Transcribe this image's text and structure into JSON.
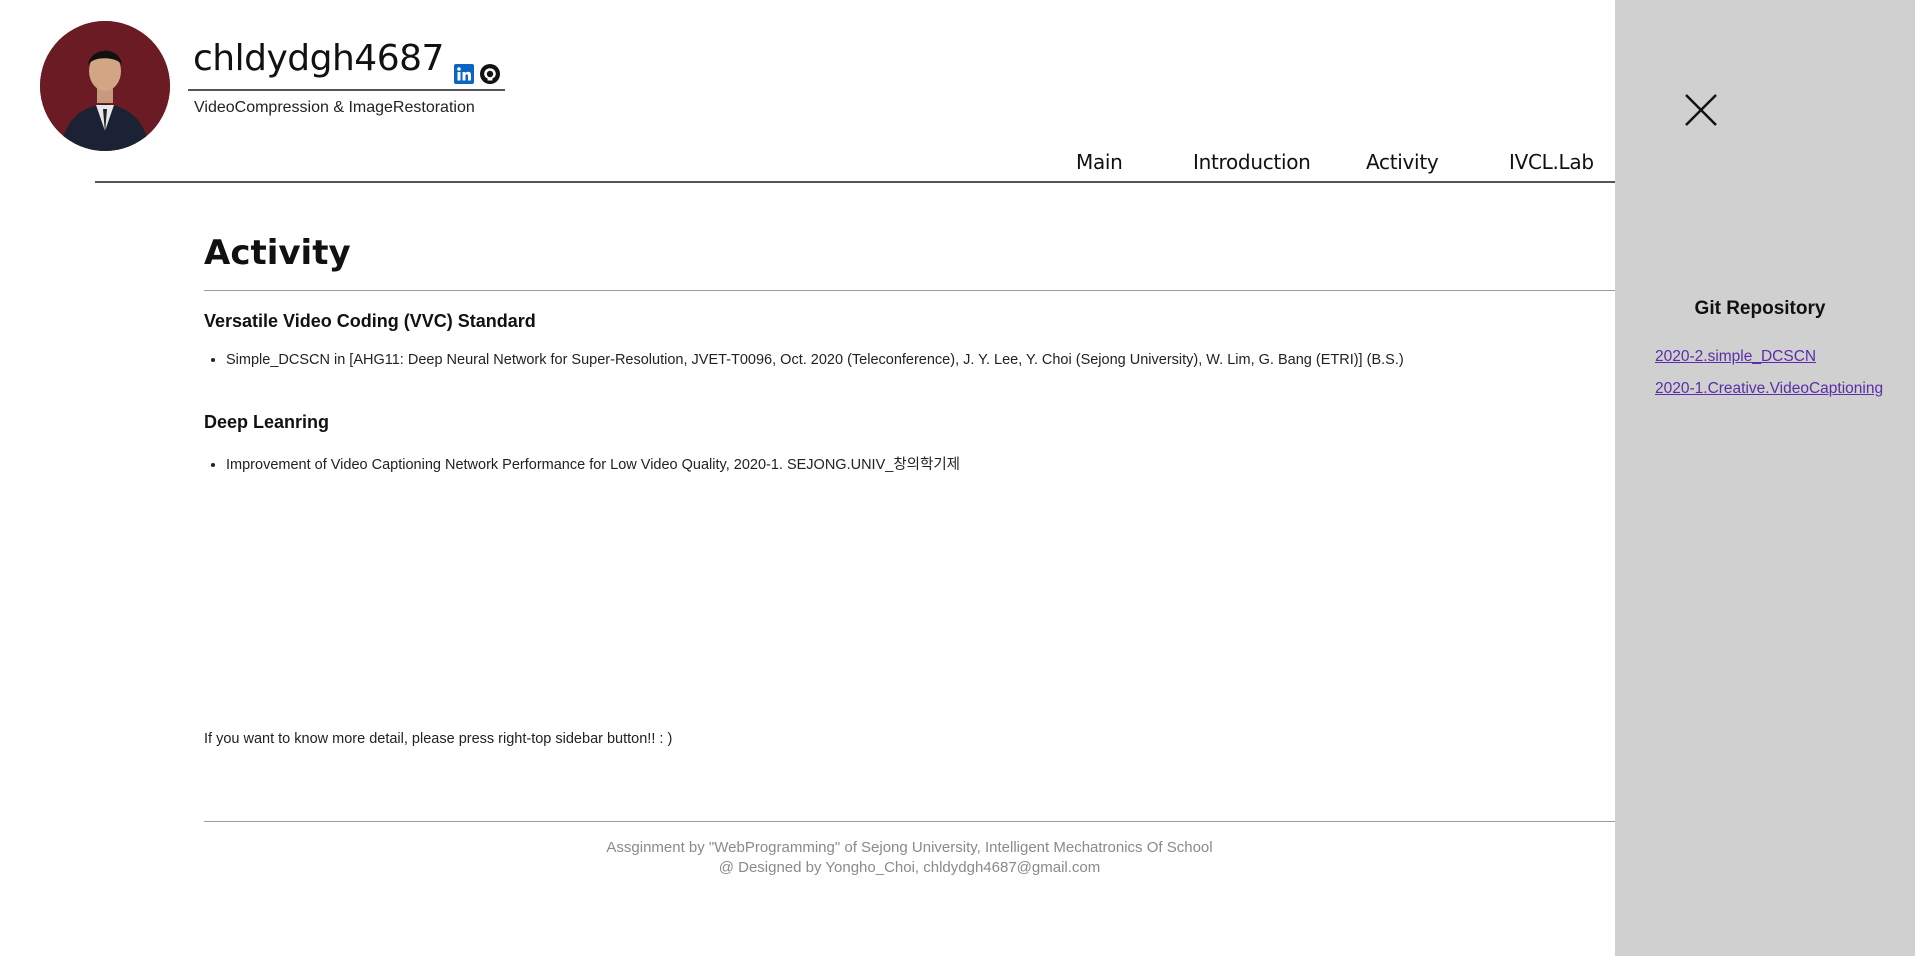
{
  "header": {
    "title": "chldydgh4687",
    "subtitle": "VideoCompression & ImageRestoration",
    "icons": [
      "linkedin-icon",
      "github-icon"
    ]
  },
  "nav": {
    "items": [
      {
        "label": "Main"
      },
      {
        "label": "Introduction"
      },
      {
        "label": "Activity"
      },
      {
        "label": "IVCL.Lab"
      }
    ]
  },
  "main": {
    "title": "Activity",
    "sections": [
      {
        "heading": "Versatile Video Coding (VVC) Standard",
        "items": [
          "Simple_DCSCN in [AHG11: Deep Neural Network for Super-Resolution, JVET-T0096, Oct. 2020 (Teleconference), J. Y. Lee, Y. Choi (Sejong University), W. Lim, G. Bang (ETRI)] (B.S.)"
        ]
      },
      {
        "heading": "Deep Leanring",
        "items": [
          "Improvement of Video Captioning Network Performance for Low Video Quality, 2020-1. SEJONG.UNIV_창의학기제"
        ]
      }
    ],
    "hint": "If you want to know more detail, please press right-top sidebar button!! : )"
  },
  "footer": {
    "line1": "Assginment by \"WebProgramming\" of Sejong University, Intelligent Mechatronics Of School",
    "line2": "@ Designed by Yongho_Choi, chldydgh4687@gmail.com"
  },
  "sidebar": {
    "heading": "Git Repository",
    "links": [
      {
        "label": "2020-2.simple_DCSCN"
      },
      {
        "label": "2020-1.Creative.VideoCaptioning"
      }
    ]
  },
  "colors": {
    "sidebar_bg": "#d0d0d0",
    "link": "#5a2ea6",
    "avatar_bg": "#6b1b24",
    "linkedin": "#0a66c2"
  }
}
